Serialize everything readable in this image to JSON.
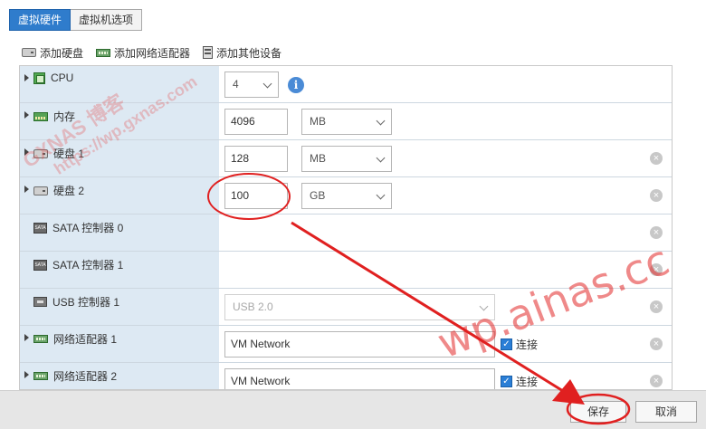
{
  "tabs": [
    {
      "label": "虚拟硬件",
      "active": true
    },
    {
      "label": "虚拟机选项",
      "active": false
    }
  ],
  "toolbar": {
    "add_disk": "添加硬盘",
    "add_nic": "添加网络适配器",
    "add_other": "添加其他设备"
  },
  "rows": {
    "cpu": {
      "label": "CPU",
      "value": "4"
    },
    "memory": {
      "label": "内存",
      "value": "4096",
      "unit": "MB"
    },
    "disk1": {
      "label": "硬盘 1",
      "value": "128",
      "unit": "MB"
    },
    "disk2": {
      "label": "硬盘 2",
      "value": "100",
      "unit": "GB"
    },
    "sata0": {
      "label": "SATA 控制器 0",
      "icon_text": "SATA"
    },
    "sata1": {
      "label": "SATA 控制器 1",
      "icon_text": "SATA"
    },
    "usb1": {
      "label": "USB 控制器 1",
      "value": "USB 2.0"
    },
    "nic1": {
      "label": "网络适配器 1",
      "value": "VM Network",
      "connect_label": "连接",
      "connected": true
    },
    "nic2": {
      "label": "网络适配器 2",
      "value": "VM Network",
      "connect_label": "连接",
      "connected": true
    }
  },
  "footer": {
    "save": "保存",
    "cancel": "取消"
  },
  "watermarks": {
    "line1": "GXNAS 博客",
    "line2": "https://wp.gxnas.com",
    "line3": "wp.ainas.cc"
  },
  "colors": {
    "accent": "#2f7ccc",
    "label_column": "#dde9f3",
    "annotation_red": "#e02020"
  },
  "icons": {
    "info": "i",
    "remove": "×",
    "check": "✓"
  }
}
